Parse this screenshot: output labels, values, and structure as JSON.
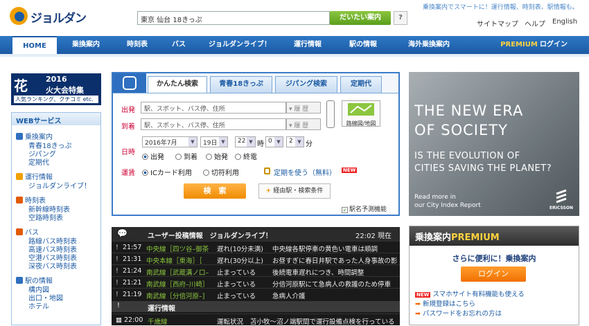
{
  "header": {
    "logo": "ジョルダン",
    "search_value": "東京 仙台 18きっぷ",
    "search_button": "だいたい案内",
    "help_button": "?",
    "tagline": "乗換案内でスマートに！運行情報、時刻表、駅情報も。",
    "links": [
      "サイトマップ",
      "ヘルプ",
      "English"
    ]
  },
  "nav": {
    "items": [
      "HOME",
      "乗換案内",
      "時刻表",
      "バス",
      "ジョルダンライブ！",
      "運行情報",
      "駅の情報",
      "海外乗換案内"
    ],
    "premium": "PREMIUM",
    "login": "ログイン"
  },
  "banner": {
    "big": "花",
    "year": "2016",
    "title": "火大会特集",
    "sub": "人気ランキング、クチコミ etc."
  },
  "web_services": {
    "title": "WEBサービス",
    "groups": [
      {
        "head": "乗換案内",
        "color": "#2e6fbf",
        "items": [
          "青春18きっぷ",
          "ジパング",
          "定期代"
        ]
      },
      {
        "head": "運行情報",
        "color": "#f0a000",
        "items": [
          "ジョルダンライブ！"
        ]
      },
      {
        "head": "時刻表",
        "color": "#e05a00",
        "items": [
          "新幹線時刻表",
          "空路時刻表"
        ]
      },
      {
        "head": "バス",
        "color": "#e05a00",
        "items": [
          "路線バス時刻表",
          "高速バス時刻表",
          "空港バス時刻表",
          "深夜バス時刻表"
        ]
      },
      {
        "head": "駅の情報",
        "color": "#2e6fbf",
        "items": [
          "構内図",
          "出口・地図",
          "ホテル"
        ]
      }
    ]
  },
  "panel": {
    "tabs": [
      "かんたん検索",
      "青春18きっぷ",
      "ジパング検索",
      "定期代"
    ],
    "from_label": "出発",
    "to_label": "到着",
    "placeholder": "駅、スポット、バス停、住所",
    "history": "履 歴",
    "route_map": "路線図/地図",
    "date_label": "日時",
    "year_month": "2016年7月",
    "day": "19日",
    "hour": "22",
    "hour_unit": "時",
    "minute": "0",
    "minute2": "2",
    "minute_unit": "分",
    "time_options": [
      "出発",
      "到着",
      "始発",
      "終電"
    ],
    "fare_label": "運賃",
    "fare_options": [
      "ICカード利用",
      "切符利用"
    ],
    "commuter": "定期を使う（無料）",
    "new_badge": "NEW",
    "search_button": "検　索",
    "cond_button": "経由駅・検索条件",
    "suggest": "駅名予測機能"
  },
  "feed": {
    "title": "ユーザー投稿情報　ジョルダンライブ！",
    "time": "22:02 現在",
    "rows": [
      {
        "time": "21:57",
        "line": "中央線［四ツ谷–御茶",
        "status": "遅れ(10分未満)",
        "msg": "中央線各駅停車の黄色い電車は順調"
      },
      {
        "time": "21:31",
        "line": "中央本線［東海］［",
        "status": "遅れ(30分以上)",
        "msg": "お昼すぎに春日井駅であった人身事故の影"
      },
      {
        "time": "21:24",
        "line": "南武線［武蔵溝ノ口–",
        "status": "止まっている",
        "msg": "後続電車遅れにつき、時間調整"
      },
      {
        "time": "21:21",
        "line": "南武線［西府–川崎］",
        "status": "止まっている",
        "msg": "分倍河原駅にて急病人の救護のため停車"
      },
      {
        "time": "21:19",
        "line": "南武線［分倍河原–]",
        "status": "止まっている",
        "msg": "急病人介護"
      }
    ],
    "ops_title": "運行情報",
    "ops_row": {
      "time": "22:00",
      "line": "千歳線",
      "status": "運転状況",
      "msg": "苫小牧〜沼ノ端駅間で運行設備点検を行っている"
    }
  },
  "ad": {
    "lines": [
      "THE NEW ERA",
      "OF SOCIETY"
    ],
    "sub": [
      "IS THE EVOLUTION OF",
      "CITIES SAVING THE PLANET?"
    ],
    "read": [
      "Read more in",
      "our City Index Report"
    ],
    "brand": "ERICSSON"
  },
  "premium": {
    "title_a": "乗換案内",
    "title_b": "PREMIUM",
    "lead": "さらに便利に！乗換案内",
    "login": "ログイン",
    "links": [
      "スマホサイト有料機能も使える",
      "新規登録はこちら",
      "パスワードをお忘れの方は"
    ],
    "new_badge": "NEW"
  }
}
